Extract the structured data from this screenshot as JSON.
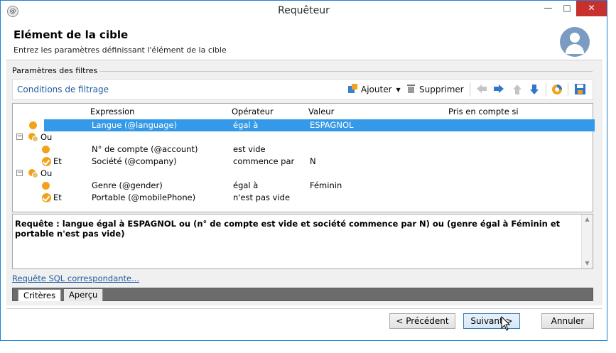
{
  "window": {
    "title": "Requêteur",
    "app_icon": "app-logo-icon",
    "minimize": "—",
    "maximize": "□",
    "close": "✕"
  },
  "header": {
    "title": "Elément de la cible",
    "subtitle": "Entrez les paramètres définissant l'élément de la cible",
    "avatar_icon": "user-avatar-icon"
  },
  "filters": {
    "legend": "Paramètres des filtres",
    "toolbar": {
      "label": "Conditions de filtrage",
      "add_label": "Ajouter",
      "delete_label": "Supprimer",
      "icons": [
        "add-condition-icon",
        "dropdown-arrow-icon",
        "trash-icon",
        "arrow-left-icon",
        "arrow-right-icon",
        "arrow-up-icon",
        "arrow-down-icon",
        "distribution-icon",
        "save-icon"
      ]
    },
    "columns": [
      "Expression",
      "Opérateur",
      "Valeur",
      "Pris en compte si"
    ],
    "rows": [
      {
        "kind": "condition",
        "level": 1,
        "expression": "Langue (@language)",
        "operator": "égal à",
        "value": "ESPAGNOL",
        "selected": true
      },
      {
        "kind": "group",
        "level": 0,
        "label": "Ou",
        "expander": "−"
      },
      {
        "kind": "condition",
        "level": 2,
        "expression": "N° de compte (@account)",
        "operator": "est vide",
        "value": ""
      },
      {
        "kind": "and",
        "level": 2,
        "label": "Et",
        "expression": "Société (@company)",
        "operator": "commence par",
        "value": "N"
      },
      {
        "kind": "group",
        "level": 0,
        "label": "Ou",
        "expander": "−"
      },
      {
        "kind": "condition",
        "level": 2,
        "expression": "Genre (@gender)",
        "operator": "égal à",
        "value": "Féminin"
      },
      {
        "kind": "and",
        "level": 2,
        "label": "Et",
        "expression": "Portable (@mobilePhone)",
        "operator": "n'est pas vide",
        "value": ""
      }
    ]
  },
  "query": {
    "text": "Requête : langue égal à ESPAGNOL ou (n° de compte est vide et société commence par N) ou (genre égal à Féminin et portable n'est pas vide)"
  },
  "sql_link": "Requête SQL correspondante...",
  "tabs": [
    {
      "label": "Critères",
      "active": true
    },
    {
      "label": "Aperçu",
      "active": false
    }
  ],
  "buttons": {
    "previous": "< Précédent",
    "next": "Suivant >",
    "cancel": "Annuler"
  },
  "colors": {
    "selection": "#3399e8",
    "node": "#f2a21d",
    "link": "#1e5a9e",
    "close": "#c7302c"
  }
}
